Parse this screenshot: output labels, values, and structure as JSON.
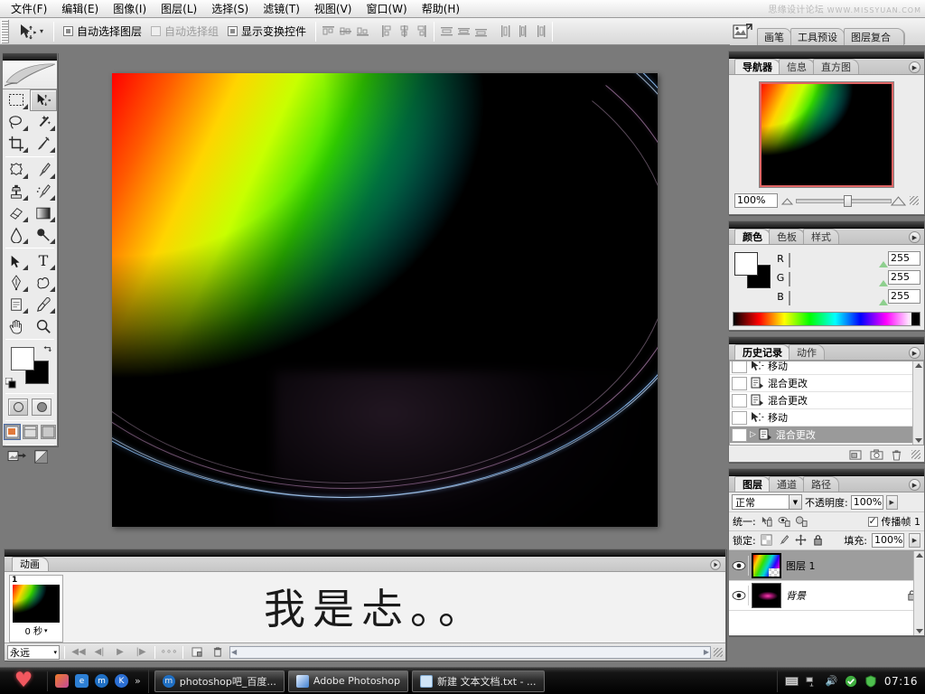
{
  "app": {
    "title": "Adobe Photoshop",
    "watermark_cn": "思缘设计论坛",
    "watermark_url": "WWW.MISSYUAN.COM"
  },
  "menubar": {
    "items": [
      {
        "label": "文件(F)"
      },
      {
        "label": "编辑(E)"
      },
      {
        "label": "图像(I)"
      },
      {
        "label": "图层(L)"
      },
      {
        "label": "选择(S)"
      },
      {
        "label": "滤镜(T)"
      },
      {
        "label": "视图(V)"
      },
      {
        "label": "窗口(W)"
      },
      {
        "label": "帮助(H)"
      }
    ]
  },
  "options_bar": {
    "auto_select_layer": "自动选择图层",
    "auto_select_group": "自动选择组",
    "show_transform": "显示变换控件",
    "checked": false
  },
  "palette_well": {
    "tabs": [
      "画笔",
      "工具预设",
      "图层复合"
    ]
  },
  "navigator": {
    "tabs": [
      "导航器",
      "信息",
      "直方图"
    ],
    "active_tab": "导航器",
    "zoom": "100%"
  },
  "color": {
    "tabs": [
      "颜色",
      "色板",
      "样式"
    ],
    "active_tab": "颜色",
    "channels": [
      {
        "label": "R",
        "value": "255"
      },
      {
        "label": "G",
        "value": "255"
      },
      {
        "label": "B",
        "value": "255"
      }
    ],
    "foreground": "#ffffff",
    "background": "#000000"
  },
  "history": {
    "tabs": [
      "历史记录",
      "动作"
    ],
    "active_tab": "历史记录",
    "items": [
      {
        "label": "移动",
        "icon": "move-icon",
        "selected": false
      },
      {
        "label": "混合更改",
        "icon": "blend-icon",
        "selected": false
      },
      {
        "label": "混合更改",
        "icon": "blend-icon",
        "selected": false
      },
      {
        "label": "移动",
        "icon": "move-icon",
        "selected": false
      },
      {
        "label": "混合更改",
        "icon": "blend-icon",
        "selected": true
      }
    ]
  },
  "layers": {
    "tabs": [
      "图层",
      "通道",
      "路径"
    ],
    "active_tab": "图层",
    "blend_mode": "正常",
    "opacity_label": "不透明度:",
    "opacity_value": "100%",
    "unify_label": "统一:",
    "propagate_label": "传播帧 1",
    "propagate_checked": true,
    "lock_label": "锁定:",
    "fill_label": "填充:",
    "fill_value": "100%",
    "items": [
      {
        "name": "图层 1",
        "selected": true,
        "locked": false,
        "visible": true
      },
      {
        "name": "背景",
        "selected": false,
        "locked": true,
        "visible": true
      }
    ]
  },
  "animation": {
    "tab": "动画",
    "frames": [
      {
        "number": "1",
        "delay": "0 秒"
      }
    ],
    "loop": "永远"
  },
  "document": {
    "artwork_text": "我是忐。。"
  },
  "taskbar": {
    "start": "heart-icon",
    "quick_launch": [
      "show-desktop-icon",
      "ie-icon",
      "maxthon-icon",
      "kingsoft-icon"
    ],
    "more": "»",
    "tasks": [
      {
        "label": "photoshop吧_百度...",
        "icon": "maxthon-icon",
        "active": false
      },
      {
        "label": "Adobe Photoshop",
        "icon": "photoshop-icon",
        "active": true
      },
      {
        "label": "新建 文本文档.txt - ...",
        "icon": "notepad-icon",
        "active": false
      }
    ],
    "tray": [
      "keyboard-icon",
      "network-icon",
      "volume-icon",
      "shield-green-icon",
      "shield-icon"
    ],
    "clock": "07:16"
  },
  "toolbox": {
    "tools": [
      {
        "name": "marquee-tool",
        "selected": false
      },
      {
        "name": "move-tool",
        "selected": true
      },
      {
        "name": "lasso-tool",
        "selected": false
      },
      {
        "name": "magic-wand-tool",
        "selected": false
      },
      {
        "name": "crop-tool",
        "selected": false
      },
      {
        "name": "slice-tool",
        "selected": false
      },
      {
        "name": "healing-brush-tool",
        "selected": false
      },
      {
        "name": "brush-tool",
        "selected": false
      },
      {
        "name": "clone-stamp-tool",
        "selected": false
      },
      {
        "name": "history-brush-tool",
        "selected": false
      },
      {
        "name": "eraser-tool",
        "selected": false
      },
      {
        "name": "gradient-tool",
        "selected": false
      },
      {
        "name": "blur-tool",
        "selected": false
      },
      {
        "name": "dodge-tool",
        "selected": false
      },
      {
        "name": "path-selection-tool",
        "selected": false
      },
      {
        "name": "type-tool",
        "selected": false
      },
      {
        "name": "pen-tool",
        "selected": false
      },
      {
        "name": "shape-tool",
        "selected": false
      },
      {
        "name": "notes-tool",
        "selected": false
      },
      {
        "name": "eyedropper-tool",
        "selected": false
      },
      {
        "name": "hand-tool",
        "selected": false
      },
      {
        "name": "zoom-tool",
        "selected": false
      }
    ]
  }
}
